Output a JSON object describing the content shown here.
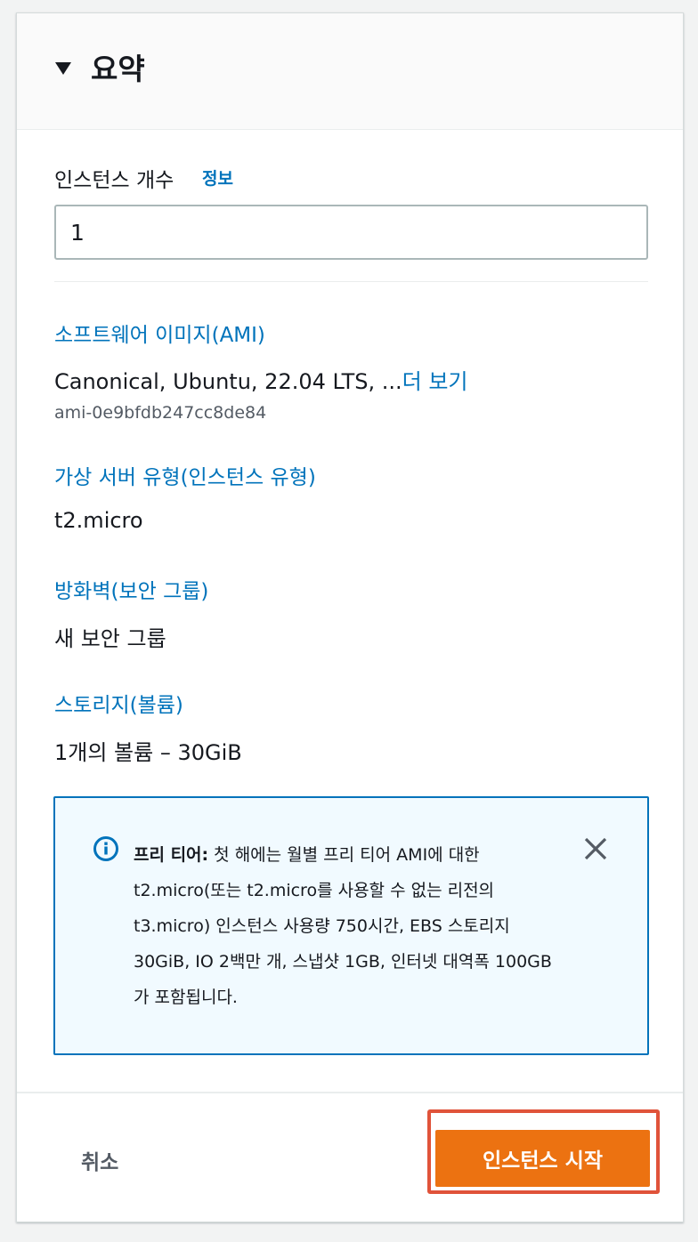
{
  "summary": {
    "title": "요약",
    "instance_count": {
      "label": "인스턴스 개수",
      "info_link": "정보",
      "value": "1"
    },
    "ami": {
      "label": "소프트웨어 이미지(AMI)",
      "value": "Canonical, Ubuntu, 22.04 LTS, ...",
      "more_link": "더 보기",
      "id": "ami-0e9bfdb247cc8de84"
    },
    "instance_type": {
      "label": "가상 서버 유형(인스턴스 유형)",
      "value": "t2.micro"
    },
    "firewall": {
      "label": "방화벽(보안 그룹)",
      "value": "새 보안 그룹"
    },
    "storage": {
      "label": "스토리지(볼륨)",
      "value": "1개의 볼륨 – 30GiB"
    },
    "free_tier_alert": {
      "title": "프리 티어:",
      "body": " 첫 해에는 월별 프리 티어 AMI에 대한 t2.micro(또는 t2.micro를 사용할 수 없는 리전의 t3.micro) 인스턴스 사용량 750시간, EBS 스토리지 30GiB, IO 2백만 개, 스냅샷 1GB, 인터넷 대역폭 100GB가 포함됩니다."
    }
  },
  "footer": {
    "cancel_label": "취소",
    "launch_label": "인스턴스 시작"
  },
  "colors": {
    "link": "#0073bb",
    "primary_button": "#ec7211",
    "alert_border": "#0073bb",
    "alert_background": "#f1faff",
    "highlight_outline": "#e0533a"
  },
  "icons": {
    "header": "caret-down-icon",
    "alert": "info-circle-icon",
    "dismiss": "close-icon"
  }
}
